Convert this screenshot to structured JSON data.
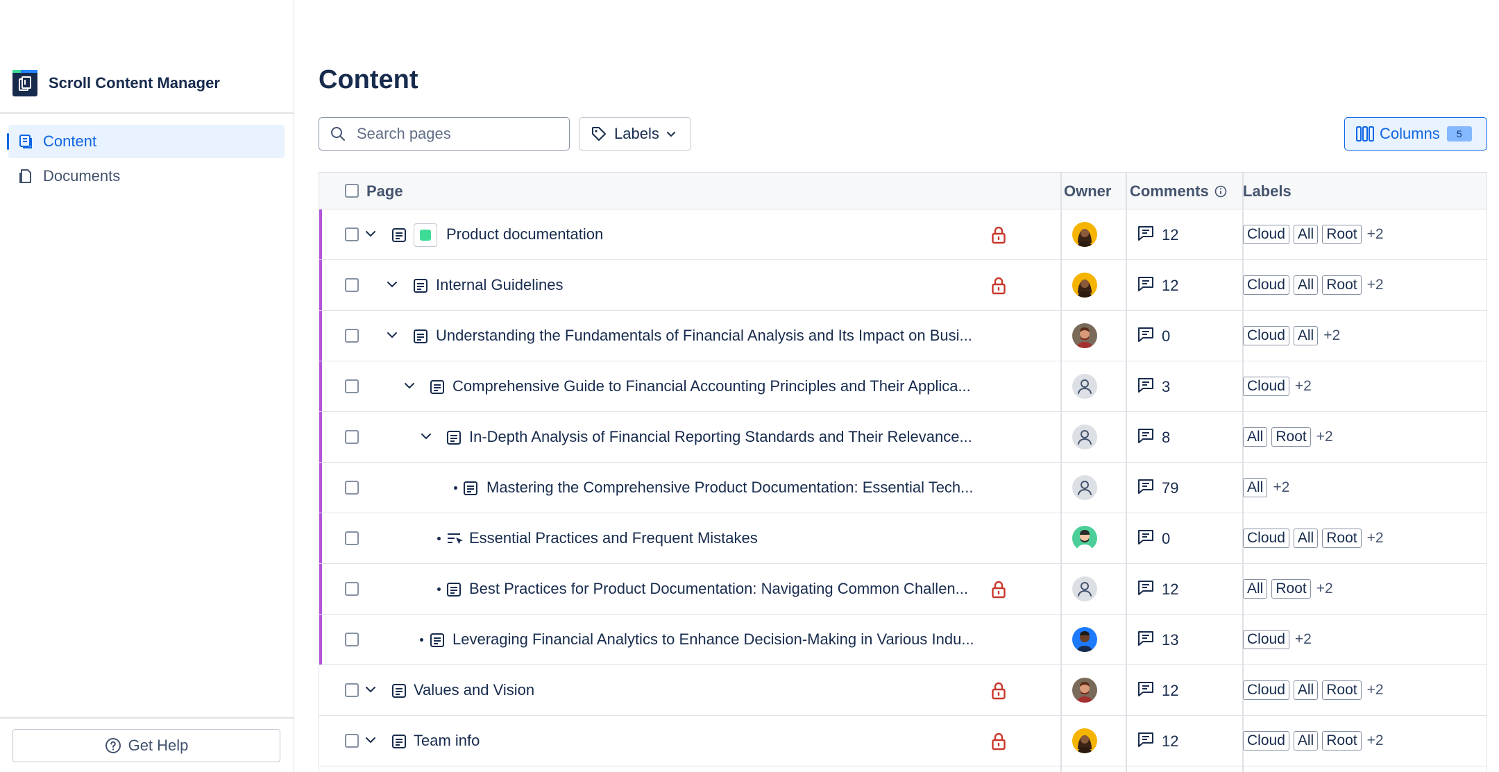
{
  "app": {
    "name": "Scroll Content Manager"
  },
  "sidebar": {
    "items": [
      {
        "label": "Content",
        "icon": "content-icon",
        "active": true
      },
      {
        "label": "Documents",
        "icon": "documents-icon",
        "active": false
      }
    ],
    "help_label": "Get Help"
  },
  "main": {
    "title": "Content",
    "search": {
      "placeholder": "Search pages",
      "value": ""
    },
    "labels_filter": "Labels",
    "columns_button": {
      "label": "Columns",
      "count": "5"
    }
  },
  "table": {
    "headers": {
      "page": "Page",
      "owner": "Owner",
      "comments": "Comments",
      "labels": "Labels"
    },
    "rows": [
      {
        "title": "Product documentation",
        "comments": "12",
        "labels": [
          "Cloud",
          "All",
          "Root"
        ],
        "more": "+2",
        "locked": true,
        "avatar": "woman-yellow"
      },
      {
        "title": "Internal Guidelines",
        "comments": "12",
        "labels": [
          "Cloud",
          "All",
          "Root"
        ],
        "more": "+2",
        "locked": true,
        "avatar": "woman-yellow"
      },
      {
        "title": "Understanding the Fundamentals of Financial Analysis and Its Impact on Busi...",
        "comments": "0",
        "labels": [
          "Cloud",
          "All"
        ],
        "more": "+2",
        "locked": false,
        "avatar": "man-brown"
      },
      {
        "title": "Comprehensive Guide to Financial Accounting Principles and Their Applica...",
        "comments": "3",
        "labels": [
          "Cloud"
        ],
        "more": "+2",
        "locked": false,
        "avatar": "default"
      },
      {
        "title": "In-Depth Analysis of Financial Reporting Standards and Their Relevance...",
        "comments": "8",
        "labels": [
          "All",
          "Root"
        ],
        "more": "+2",
        "locked": false,
        "avatar": "default"
      },
      {
        "title": "Mastering the Comprehensive Product Documentation: Essential Tech...",
        "comments": "79",
        "labels": [
          "All"
        ],
        "more": "+2",
        "locked": false,
        "avatar": "default"
      },
      {
        "title": "Essential Practices and Frequent Mistakes",
        "comments": "0",
        "labels": [
          "Cloud",
          "All",
          "Root"
        ],
        "more": "+2",
        "locked": false,
        "avatar": "man-green"
      },
      {
        "title": "Best Practices for Product Documentation: Navigating Common Challen...",
        "comments": "12",
        "labels": [
          "All",
          "Root"
        ],
        "more": "+2",
        "locked": true,
        "avatar": "default"
      },
      {
        "title": "Leveraging Financial Analytics to Enhance Decision-Making in Various Indu...",
        "comments": "13",
        "labels": [
          "Cloud"
        ],
        "more": "+2",
        "locked": false,
        "avatar": "man-blue"
      },
      {
        "title": "Values and Vision",
        "comments": "12",
        "labels": [
          "Cloud",
          "All",
          "Root"
        ],
        "more": "+2",
        "locked": true,
        "avatar": "man-brown"
      },
      {
        "title": "Team info",
        "comments": "12",
        "labels": [
          "Cloud",
          "All",
          "Root"
        ],
        "more": "+2",
        "locked": true,
        "avatar": "woman-yellow"
      }
    ]
  },
  "colors": {
    "accent": "#0c66e4",
    "tree_accent": "#b455d8",
    "lock": "#c9372c"
  }
}
